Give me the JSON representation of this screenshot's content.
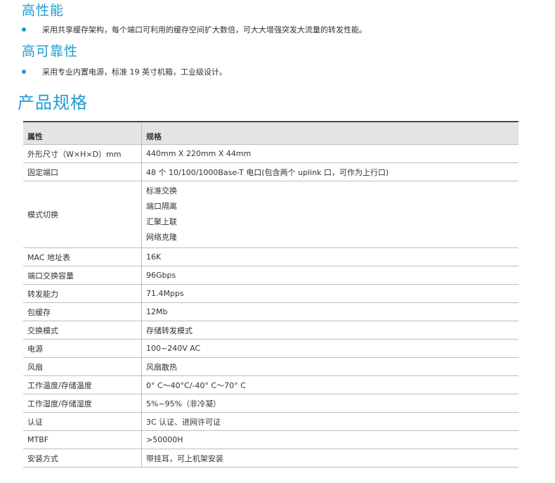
{
  "sections": {
    "performance": {
      "title": "高性能",
      "bullet": "采用共享缓存架构，每个端口可利用的缓存空间扩大数倍，可大大增强突发大流量的转发性能。"
    },
    "reliability": {
      "title": "高可靠性",
      "bullet": "采用专业内置电源，标准 19 英寸机箱，工业级设计。"
    }
  },
  "specs": {
    "title": "产品规格",
    "header": {
      "attr": "属性",
      "spec": "规格"
    },
    "rows": [
      {
        "attr": "外形尺寸（W×H×D）mm",
        "value": "440mm X 220mm X 44mm"
      },
      {
        "attr": "固定端口",
        "value": "48 个 10/100/1000Base-T 电口(包含两个 uplink 口，可作为上行口)"
      },
      {
        "attr": "模式切换",
        "values": [
          "标准交换",
          "端口隔离",
          "汇聚上联",
          "网络克隆"
        ]
      },
      {
        "attr": "MAC 地址表",
        "value": "16K"
      },
      {
        "attr": "端口交换容量",
        "value": "96Gbps"
      },
      {
        "attr": "转发能力",
        "value": "71.4Mpps"
      },
      {
        "attr": "包缓存",
        "value": "12Mb"
      },
      {
        "attr": "交换模式",
        "value": "存储转发模式"
      },
      {
        "attr": "电源",
        "value": "100~240V AC"
      },
      {
        "attr": "风扇",
        "value": "风扇散热"
      },
      {
        "attr": "工作温度/存储温度",
        "value": "0° C～40°C/-40° C～70° C"
      },
      {
        "attr": "工作湿度/存储湿度",
        "value": "5%~95%（非冷凝）"
      },
      {
        "attr": "认证",
        "value": "3C 认证、进网许可证"
      },
      {
        "attr": "MTBF",
        "value": ">50000H"
      },
      {
        "attr": "安装方式",
        "value": "带挂耳，可上机架安装"
      }
    ]
  },
  "colors": {
    "accent": "#1f9bd1",
    "header_bg": "#e4e4e4",
    "text": "#333333"
  }
}
